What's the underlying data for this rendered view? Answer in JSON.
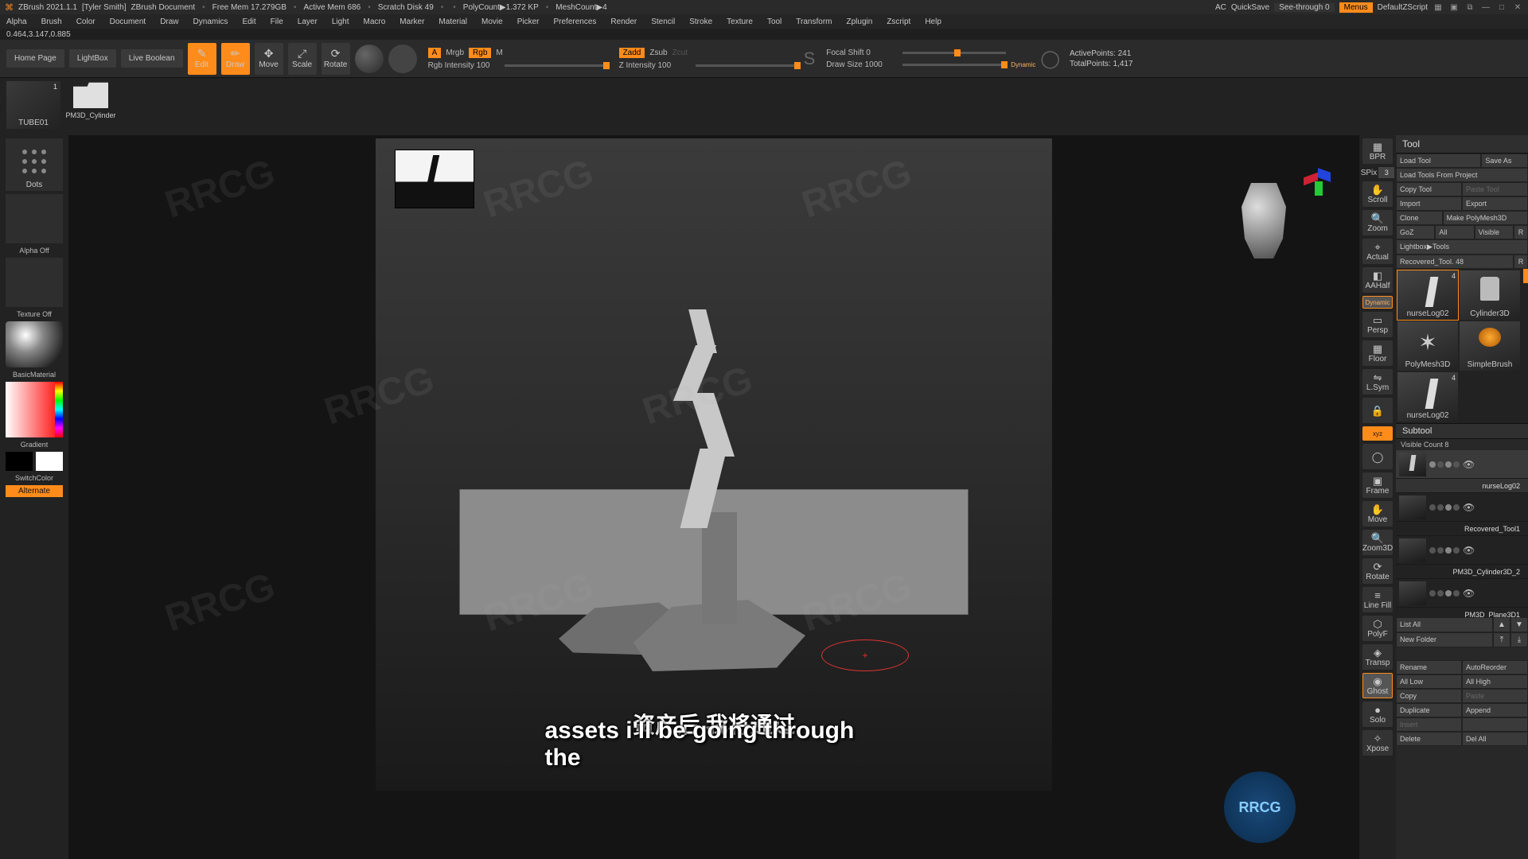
{
  "title": {
    "app": "ZBrush 2021.1.1",
    "user": "[Tyler Smith]",
    "doc": "ZBrush Document",
    "freemem": "Free Mem 17.279GB",
    "activemem": "Active Mem 686",
    "scratch": "Scratch Disk 49",
    "polycount": "PolyCount▶1.372 KP",
    "meshcount": "MeshCount▶4",
    "ac": "AC",
    "quicksave": "QuickSave",
    "seethrough": "See-through  0",
    "menus": "Menus",
    "script": "DefaultZScript"
  },
  "menu": [
    "Alpha",
    "Brush",
    "Color",
    "Document",
    "Draw",
    "Dynamics",
    "Edit",
    "File",
    "Layer",
    "Light",
    "Macro",
    "Marker",
    "Material",
    "Movie",
    "Picker",
    "Preferences",
    "Render",
    "Stencil",
    "Stroke",
    "Texture",
    "Tool",
    "Transform",
    "Zplugin",
    "Zscript",
    "Help"
  ],
  "stats": "0.464,3.147,0.885",
  "shelf": {
    "home": "Home Page",
    "lightbox": "LightBox",
    "livebool": "Live Boolean",
    "edit": "Edit",
    "draw": "Draw",
    "move": "Move",
    "scale": "Scale",
    "rotate": "Rotate",
    "a": "A",
    "mrgb": "Mrgb",
    "rgb": "Rgb",
    "m": "M",
    "rgb_int": "Rgb Intensity 100",
    "zadd": "Zadd",
    "zsub": "Zsub",
    "zcut": "Zcut",
    "z_int": "Z Intensity 100",
    "focal": "Focal Shift 0",
    "drawsize": "Draw Size 1000",
    "dynamic": "Dynamic",
    "activepts": "ActivePoints: 241",
    "totalpts": "TotalPoints: 1,417"
  },
  "picker": {
    "tube_tile": "TUBE01",
    "tube_num": "1",
    "folder_label": "PM3D_Cylinder"
  },
  "left": {
    "dots": "Dots",
    "alpha": "Alpha Off",
    "texture": "Texture Off",
    "material": "BasicMaterial",
    "gradient": "Gradient",
    "switch": "SwitchColor",
    "alternate": "Alternate"
  },
  "rail": {
    "bpr": "BPR",
    "spix_label": "SPix",
    "spix_val": "3",
    "scroll": "Scroll",
    "zoom": "Zoom",
    "actual": "Actual",
    "aahalf": "AAHalf",
    "persp": "Persp",
    "floor": "Floor",
    "lsym": "L.Sym",
    "xyz": "xyz",
    "frame": "Frame",
    "move": "Move",
    "zoom3d": "Zoom3D",
    "rotate": "Rotate",
    "linefill": "Line Fill",
    "polyf": "PolyF",
    "transp": "Transp",
    "ghost": "Ghost",
    "solo": "Solo",
    "xpose": "Xpose"
  },
  "tool": {
    "header": "Tool",
    "load": "Load Tool",
    "saveas": "Save As",
    "loadproj": "Load Tools From Project",
    "copy": "Copy Tool",
    "paste": "Paste Tool",
    "import": "Import",
    "export": "Export",
    "clone": "Clone",
    "makepoly": "Make PolyMesh3D",
    "goz": "GoZ",
    "all": "All",
    "visible": "Visible",
    "r": "R",
    "lightbox_tools": "Lightbox▶Tools",
    "recovered": "Recovered_Tool. 48",
    "tiles": [
      {
        "name": "nurseLog02",
        "num": "4"
      },
      {
        "name": "Cylinder3D",
        "num": ""
      },
      {
        "name": "PolyMesh3D",
        "num": ""
      },
      {
        "name": "SimpleBrush",
        "num": ""
      },
      {
        "name": "nurseLog02",
        "num": "4"
      }
    ]
  },
  "subtool": {
    "header": "Subtool",
    "visible_count": "Visible Count 8",
    "items": [
      {
        "name": "nurseLog02"
      },
      {
        "name": "Recovered_Tool1"
      },
      {
        "name": "PM3D_Cylinder3D_2"
      },
      {
        "name": "PM3D_Plane3D1"
      }
    ],
    "listall": "List All",
    "newfolder": "New Folder",
    "rename": "Rename",
    "autoreorder": "AutoReorder",
    "alllow": "All Low",
    "allhigh": "All High",
    "copy": "Copy",
    "paste": "Paste",
    "duplicate": "Duplicate",
    "append": "Append",
    "insert": "Insert",
    "delete": "Delete",
    "delall": "Del All"
  },
  "subtitle": {
    "cn": "资产后 我将通过",
    "en": "assets i'll be going through the"
  }
}
